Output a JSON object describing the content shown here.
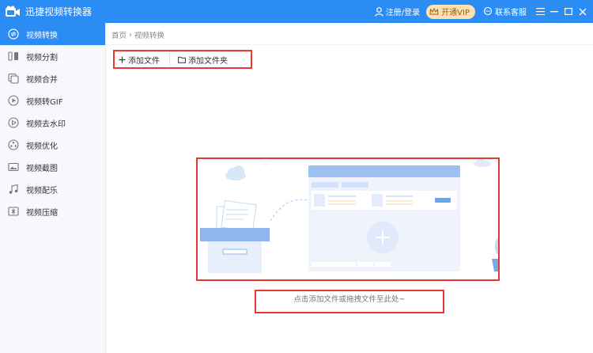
{
  "app": {
    "title": "迅捷视频转换器"
  },
  "titlebar": {
    "login_label": "注册/登录",
    "vip_label": "开通VIP",
    "service_label": "联系客服"
  },
  "sidebar": {
    "items": [
      {
        "label": "视频转换",
        "icon": "convert-icon",
        "active": true
      },
      {
        "label": "视频分割",
        "icon": "split-icon"
      },
      {
        "label": "视频合并",
        "icon": "merge-icon"
      },
      {
        "label": "视频转GIF",
        "icon": "gif-icon"
      },
      {
        "label": "视频去水印",
        "icon": "watermark-icon"
      },
      {
        "label": "视频优化",
        "icon": "optimize-icon"
      },
      {
        "label": "视频截图",
        "icon": "screenshot-icon"
      },
      {
        "label": "视频配乐",
        "icon": "music-icon"
      },
      {
        "label": "视频压缩",
        "icon": "compress-icon"
      }
    ]
  },
  "breadcrumb": {
    "home": "首页",
    "current": "视频转换"
  },
  "toolbar": {
    "add_file_label": "添加文件",
    "add_folder_label": "添加文件夹"
  },
  "dropzone": {
    "hint": "点击添加文件或拖拽文件至此处~"
  },
  "colors": {
    "accent": "#2b8cf4",
    "highlight": "#e53935",
    "vip_bg": "#fde3b3"
  }
}
